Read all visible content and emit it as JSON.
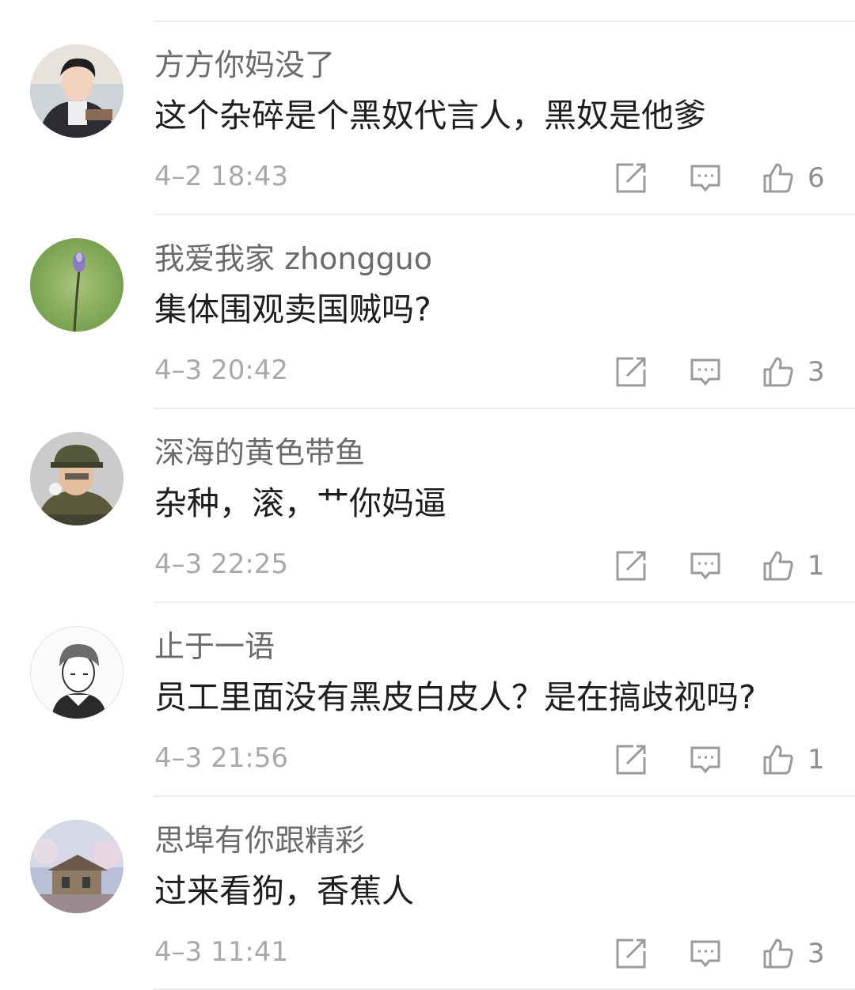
{
  "comments": [
    {
      "username": "方方你妈没了",
      "text": "这个杂碎是个黑奴代言人，黑奴是他爹",
      "time": "4–2 18:43",
      "likes": "6"
    },
    {
      "username": "我爱我家 zhongguo",
      "text": "集体围观卖国贼吗?",
      "time": "4–3 20:42",
      "likes": "3"
    },
    {
      "username": "深海的黄色带鱼",
      "text": "杂种，滚，艹你妈逼",
      "time": "4–3 22:25",
      "likes": "1"
    },
    {
      "username": "止于一语",
      "text": "员工里面没有黑皮白皮人？是在搞歧视吗?",
      "time": "4–3 21:56",
      "likes": "1"
    },
    {
      "username": "思埠有你跟精彩",
      "text": "过来看狗，香蕉人",
      "time": "4–3 11:41",
      "likes": "3"
    }
  ],
  "icons": {
    "share": "share-icon",
    "comment": "comment-icon",
    "like": "thumbs-up-icon"
  },
  "colors": {
    "username": "#6b6b6b",
    "text": "#1e1e1e",
    "time": "#a9a9a9",
    "icon": "#9a9a9a",
    "divider": "#ececec"
  }
}
